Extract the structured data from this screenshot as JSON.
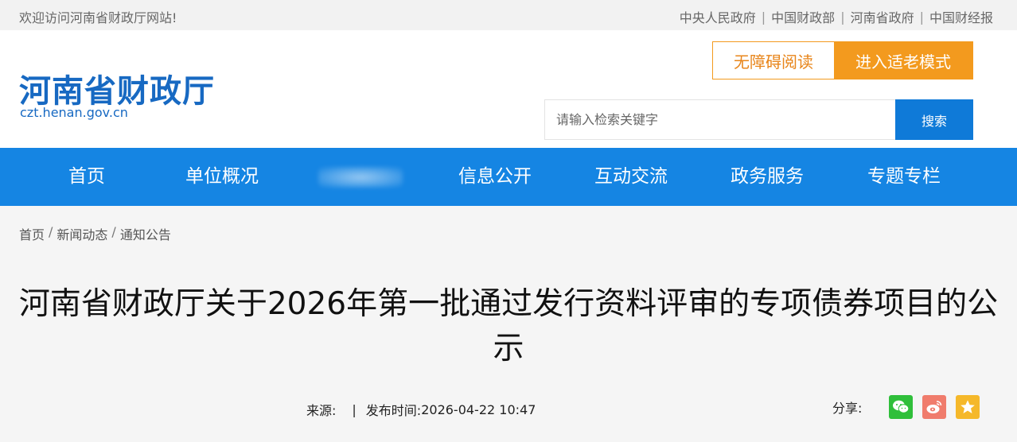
{
  "topbar": {
    "welcome": "欢迎访问河南省财政厅网站!",
    "links": [
      "中央人民政府",
      "中国财政部",
      "河南省政府",
      "中国财经报"
    ]
  },
  "header": {
    "logo_cn": "河南省财政厅",
    "logo_en": "czt.henan.gov.cn",
    "accessible_label": "无障碍阅读",
    "elder_mode_label": "进入适老模式",
    "search_placeholder": "请输入检索关键字",
    "search_button": "搜索"
  },
  "nav": {
    "items": [
      "首页",
      "单位概况",
      "信息公开",
      "互动交流",
      "政务服务",
      "专题专栏"
    ]
  },
  "breadcrumb": [
    "首页",
    "新闻动态",
    "通知公告"
  ],
  "article": {
    "title": "河南省财政厅关于2026年第一批通过发行资料评审的专项债券项目的公示",
    "source_label": "来源:",
    "separator": "|",
    "publish_label": "发布时间:",
    "publish_time": "2026-04-22 10:47",
    "share_label": "分享:"
  },
  "colors": {
    "brand_blue": "#1585e3",
    "logo_blue": "#1769c2",
    "orange": "#f39a1e"
  },
  "icons": [
    "wechat-icon",
    "weibo-icon",
    "favorite-star-icon"
  ]
}
